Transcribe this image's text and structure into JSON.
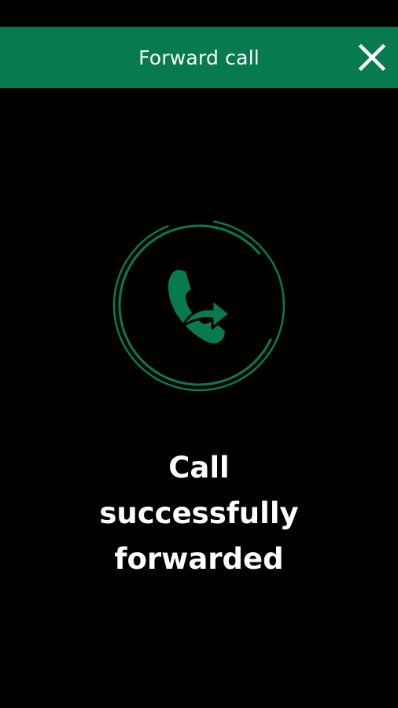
{
  "header": {
    "title": "Forward call",
    "close_icon": "close-icon"
  },
  "status": {
    "icon": "call-forwarded-icon",
    "lines": [
      "Call",
      "successfully",
      "forwarded"
    ]
  },
  "colors": {
    "accent": "#077b4f",
    "background": "#000000",
    "text": "#ffffff"
  }
}
